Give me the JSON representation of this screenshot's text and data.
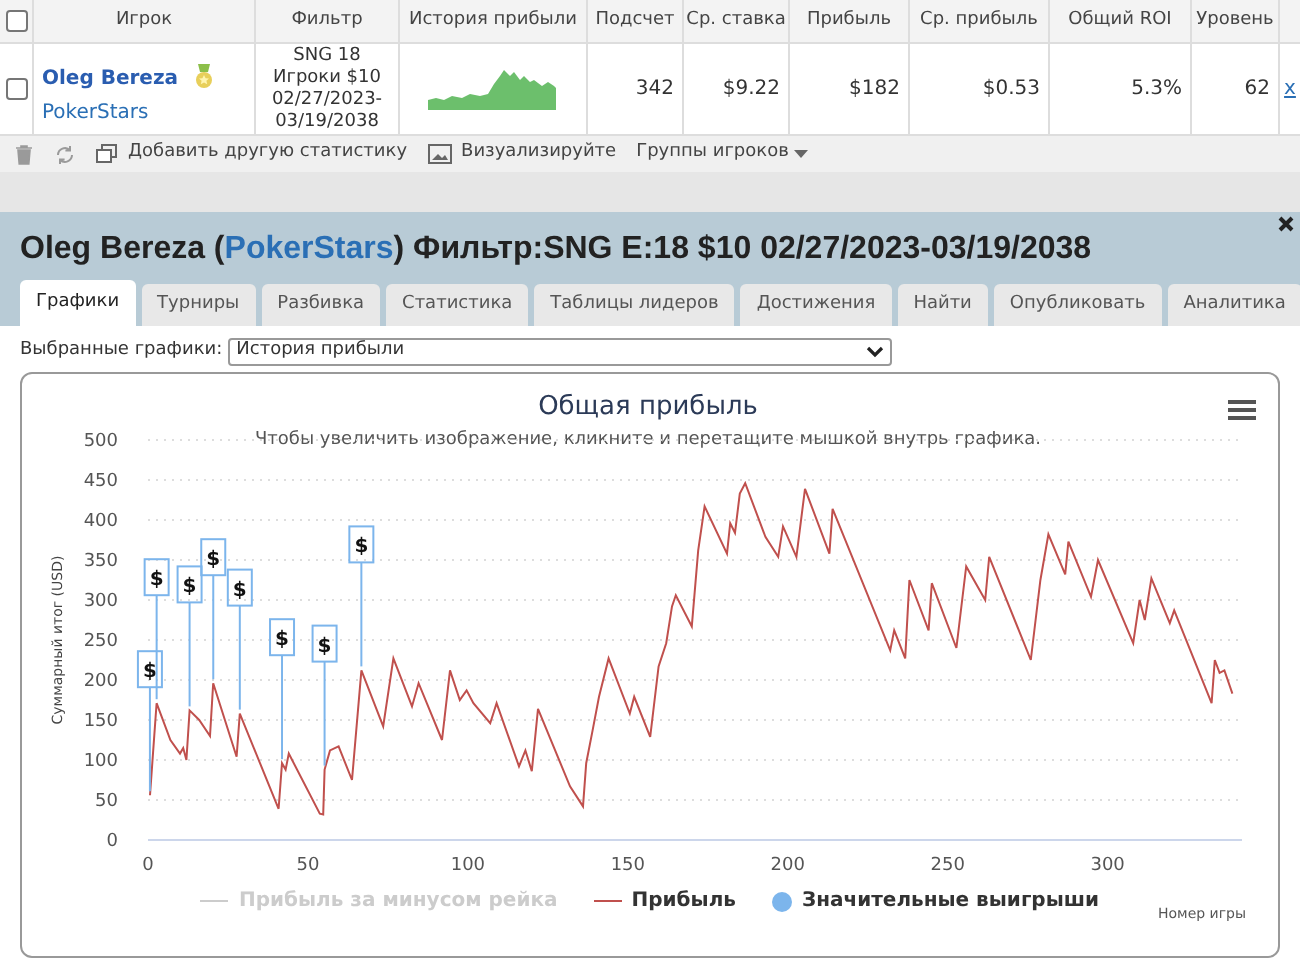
{
  "table": {
    "select_all": {
      "checked": false
    },
    "columns": [
      "Игрок",
      "Фильтр",
      "История прибыли",
      "Подсчет",
      "Ср. ставка",
      "Прибыль",
      "Ср. прибыль",
      "Общий ROI",
      "Уровень"
    ],
    "rows": [
      {
        "checked": false,
        "cells": [
          {
            "kind": "player",
            "text": "Oleg Bereza",
            "site": "PokerStars"
          },
          {
            "kind": "filter",
            "text": "SNG 18 Игроки $10 02/27/2023-03/19/2038"
          },
          {
            "kind": "sparkline"
          },
          {
            "kind": "number",
            "text": "342"
          },
          {
            "kind": "number",
            "text": "$9.22"
          },
          {
            "kind": "number",
            "text": "$182"
          },
          {
            "kind": "number",
            "text": "$0.53"
          },
          {
            "kind": "number",
            "text": "5.3%"
          },
          {
            "kind": "number",
            "text": "62"
          }
        ],
        "remove": "x"
      }
    ]
  },
  "toolbar": [
    {
      "kind": "trash"
    },
    {
      "kind": "refresh"
    },
    {
      "kind": "add",
      "label": "Добавить другую статистику"
    },
    {
      "kind": "chart",
      "label": "Визуализируйте"
    },
    {
      "kind": "dropdown",
      "label": "Группы игроков"
    }
  ],
  "panel": {
    "title_before": "Oleg Bereza (",
    "title_link": "PokerStars",
    "title_after": ") Фильтр:SNG E:18 $10 02/27/2023-03/19/2038",
    "tabs": [
      {
        "label": "Графики",
        "selected": true
      },
      {
        "label": "Турниры",
        "selected": false
      },
      {
        "label": "Разбивка",
        "selected": false
      },
      {
        "label": "Статистика",
        "selected": false
      },
      {
        "label": "Таблицы лидеров",
        "selected": false
      },
      {
        "label": "Достижения",
        "selected": false
      },
      {
        "label": "Найти",
        "selected": false
      },
      {
        "label": "Опубликовать",
        "selected": false
      },
      {
        "label": "Аналитика",
        "selected": false
      }
    ],
    "select_label": "Выбранные графики:",
    "select_value": "История прибыли",
    "chart": {
      "subtitle": "Чтобы увеличить изображение, кликните и перетащите мышкой внутрь графика.",
      "legend": [
        {
          "label": "Прибыль за минусом рейка",
          "kind": "line",
          "hidden": true
        },
        {
          "kind": "series"
        },
        {
          "label": "Значительные выигрыши",
          "kind": "dot",
          "hidden": false,
          "color": "#7cb5ec"
        }
      ],
      "chart_data": {
        "type": "line",
        "title": "Общая прибыль",
        "xlabel": "Номер игры",
        "ylabel": "Суммарный итог (USD)",
        "x": [
          0.6,
          2.7,
          7,
          10,
          11,
          12,
          13,
          16,
          19.4,
          20.4,
          27.7,
          28.7,
          40.8,
          41.9,
          43,
          44,
          53.7,
          54.8,
          55.2,
          56.9,
          59.6,
          63.8,
          66.7,
          73.5,
          76.7,
          82.5,
          84.6,
          91.9,
          94.4,
          97.5,
          99.6,
          101.7,
          107,
          109,
          116,
          118,
          120,
          121.9,
          131.9,
          136,
          137,
          139,
          141,
          144,
          150.6,
          152,
          157,
          159.6,
          162,
          163.8,
          165,
          170,
          172,
          174,
          181,
          182,
          183.5,
          185,
          186.7,
          193,
          197,
          198.5,
          202.7,
          205.4,
          213,
          214,
          232,
          233.3,
          236.7,
          238,
          244,
          245,
          252.7,
          255.8,
          261.7,
          263,
          276,
          279,
          281.5,
          286.7,
          287.7,
          294.8,
          297,
          308,
          310,
          311.6,
          313.7,
          319.4,
          320.8,
          332.5,
          333.5,
          335,
          336.5,
          339
        ],
        "series": [
          {
            "name": "Прибыль",
            "color": "#c0504d",
            "values": [
              56,
              171,
              125,
              108,
              115,
              100,
              162,
              150,
              130,
              196,
              104,
              158,
              39,
              96,
              88,
              108,
              33,
              32,
              88,
              112,
              117,
              75,
              212,
              142,
              227,
              167,
              196,
              125,
              212,
              175,
              187,
              171,
              146,
              171,
              92,
              112,
              86,
              164,
              67,
              42,
              96,
              137,
              179,
              227,
              158,
              179,
              129,
              217,
              246,
              292,
              306,
              267,
              362,
              417,
              358,
              396,
              384,
              433,
              446,
              379,
              354,
              392,
              354,
              439,
              358,
              414,
              237,
              262,
              227,
              325,
              262,
              321,
              240,
              342,
              300,
              354,
              225,
              325,
              382,
              332,
              373,
              304,
              350,
              246,
              300,
              275,
              327,
              271,
              287,
              171,
              225,
              209,
              212,
              183
            ]
          }
        ],
        "grid": true,
        "xlim": [
          0,
          342
        ],
        "ylim": [
          0,
          500
        ],
        "xticks": [
          0,
          50,
          100,
          150,
          200,
          250,
          300
        ],
        "yticks": [
          0,
          50,
          100,
          150,
          200,
          250,
          300,
          350,
          400,
          450,
          500
        ],
        "annotations": [
          {
            "x": 0.6,
            "y": 56,
            "text": "$"
          },
          {
            "x": 2.7,
            "y": 171,
            "text": "$"
          },
          {
            "x": 13,
            "y": 162,
            "text": "$"
          },
          {
            "x": 20.4,
            "y": 196,
            "text": "$"
          },
          {
            "x": 28.7,
            "y": 158,
            "text": "$"
          },
          {
            "x": 41.9,
            "y": 96,
            "text": "$"
          },
          {
            "x": 55.2,
            "y": 88,
            "text": "$"
          },
          {
            "x": 66.7,
            "y": 212,
            "text": "$"
          }
        ]
      }
    }
  }
}
